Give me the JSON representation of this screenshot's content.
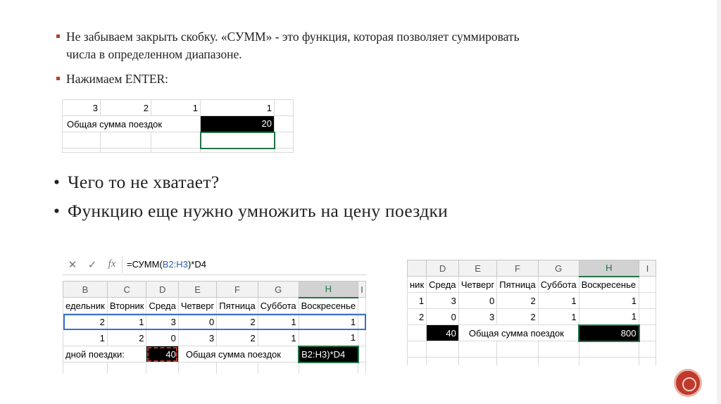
{
  "bullets_small": [
    {
      "line1": "Не забываем закрыть скобку. «СУММ» - это функция, которая позволяет суммировать",
      "line2": "числа в определенном диапазоне."
    },
    {
      "line1": "Нажимаем ENTER:"
    }
  ],
  "bullets_big": [
    "Чего то не хватает?",
    "Функцию еще нужно умножить на цену поездки"
  ],
  "sheet1": {
    "row1": [
      "3",
      "2",
      "1",
      "1"
    ],
    "label": "Общая сумма поездок",
    "total": "20"
  },
  "sheet2": {
    "formula": "=СУММ(",
    "formula_ref": "B2:H3",
    "formula_tail": ")*D4",
    "columns": [
      "B",
      "C",
      "D",
      "E",
      "F",
      "G",
      "H",
      "I"
    ],
    "days": [
      "едельник",
      "Вторник",
      "Среда",
      "Четверг",
      "Пятница",
      "Суббота",
      "Воскресенье"
    ],
    "row2": [
      "2",
      "1",
      "3",
      "0",
      "2",
      "1",
      "1"
    ],
    "row3": [
      "1",
      "2",
      "0",
      "3",
      "2",
      "1",
      "1"
    ],
    "label_left": "дной поездки:",
    "d4": "40",
    "label_total": "Общая сумма поездок",
    "edit_cell": "B2:H3)*D4"
  },
  "sheet3": {
    "columns": [
      "D",
      "E",
      "F",
      "G",
      "H",
      "I"
    ],
    "days": [
      "Среда",
      "Четверг",
      "Пятница",
      "Суббота",
      "Воскресенье"
    ],
    "row2_a": "1",
    "row2": [
      "3",
      "0",
      "2",
      "1",
      "1"
    ],
    "row3_a": "2",
    "row3": [
      "0",
      "3",
      "2",
      "1",
      "1"
    ],
    "d4": "40",
    "label_total": "Общая сумма поездок",
    "total": "800",
    "col_prefix": "ник"
  }
}
